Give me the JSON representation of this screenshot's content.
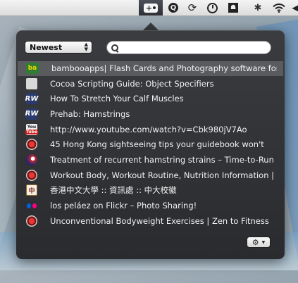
{
  "menubar": {
    "active_item": {
      "label": "+",
      "icon": "bookmark-plus-icon"
    },
    "items": [
      {
        "name": "quicksilver-icon",
        "glyph": "Q"
      },
      {
        "name": "sync-icon",
        "glyph": "⟳"
      },
      {
        "name": "timer-icon",
        "glyph": ""
      },
      {
        "name": "app-box-icon",
        "glyph": "☗"
      },
      {
        "name": "bluetooth-icon",
        "glyph": "✱"
      },
      {
        "name": "wifi-icon",
        "glyph": ""
      },
      {
        "name": "volume-icon",
        "glyph": "◀"
      }
    ]
  },
  "popover": {
    "sort": {
      "selected": "Newest",
      "arrows": "▲\n▼"
    },
    "search": {
      "value": "",
      "placeholder": ""
    },
    "bookmarks": [
      {
        "icon": "ba",
        "icon_text": "ba",
        "title": "bambooapps| Flash Cards and Photography software for",
        "selected": true
      },
      {
        "icon": "apple",
        "icon_text": "",
        "title": "Cocoa Scripting Guide: Object Specifiers"
      },
      {
        "icon": "rw",
        "icon_text": "RW",
        "title": "How To Stretch Your Calf Muscles"
      },
      {
        "icon": "rw",
        "icon_text": "RW",
        "title": "Prehab: Hamstrings"
      },
      {
        "icon": "yt",
        "icon_text": "You Tube",
        "title": "http://www.youtube.com/watch?v=Cbk980jV7Ao"
      },
      {
        "icon": "redcirc",
        "icon_text": "",
        "title": "45 Hong Kong sightseeing tips your guidebook won't"
      },
      {
        "icon": "runner",
        "icon_text": "",
        "title": "Treatment of recurrent hamstring strains – Time-to-Run"
      },
      {
        "icon": "redcirc",
        "icon_text": "",
        "title": "Workout Body, Workout Routine, Nutrition Information |"
      },
      {
        "icon": "cuhk",
        "icon_text": "中",
        "title": "香港中文大學 :: 資訊處 :: 中大校徽"
      },
      {
        "icon": "flickr",
        "icon_text": "",
        "title": "los peláez on Flickr – Photo Sharing!"
      },
      {
        "icon": "redcirc",
        "icon_text": "",
        "title": "Unconventional Bodyweight Exercises | Zen to Fitness"
      }
    ],
    "settings": {
      "gear": "⚙",
      "caret": "▼"
    }
  },
  "colors": {
    "popover_bg": "#2e2f33",
    "selected_row": "#595b5f",
    "flickr_blue": "#0063dc",
    "flickr_pink": "#ff0084"
  }
}
